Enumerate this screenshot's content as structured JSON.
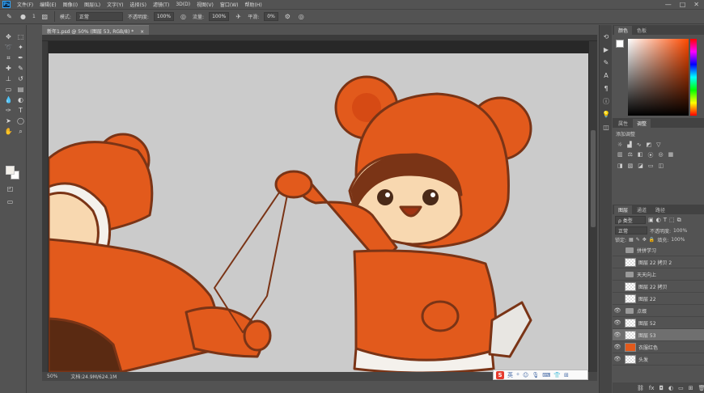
{
  "menubar": {
    "logo": "Ps",
    "items": [
      "文件(F)",
      "编辑(E)",
      "图像(I)",
      "图层(L)",
      "文字(Y)",
      "选择(S)",
      "滤镜(T)",
      "3D(D)",
      "视图(V)",
      "窗口(W)",
      "帮助(H)"
    ],
    "window_controls": [
      "—",
      "□",
      "✕"
    ]
  },
  "options": {
    "brush_size": "1",
    "mode_label": "模式:",
    "mode_value": "正常",
    "opacity_label": "不透明度:",
    "opacity_value": "100%",
    "flow_label": "流量:",
    "flow_value": "100%",
    "smoothing_label": "平滑:",
    "smoothing_value": "0%"
  },
  "document": {
    "tab_title": "新年1.psd @ 50% (图层 53, RGB/8) *",
    "tab_close": "×"
  },
  "statusbar": {
    "zoom": "50%",
    "doc_size": "文档:24.9M/624.1M"
  },
  "ime": {
    "logo": "S",
    "mode": "英"
  },
  "panels": {
    "color_tabs": [
      "颜色",
      "色板"
    ],
    "adjust_tabs": [
      "属性",
      "调整"
    ],
    "adjust_title": "添加调整",
    "layer_tabs": [
      "图层",
      "通道",
      "路径"
    ],
    "filter_label": "ρ 类型",
    "blend_mode": "正常",
    "opacity_label": "不透明度:",
    "opacity_value": "100%",
    "lock_label": "锁定:",
    "fill_label": "填充:",
    "fill_value": "100%"
  },
  "layers": [
    {
      "name": "拼拼学习",
      "type": "folder",
      "visible": false,
      "selected": false
    },
    {
      "name": "图层 22 拷贝 2",
      "type": "layer",
      "visible": false,
      "selected": false
    },
    {
      "name": "天天向上",
      "type": "folder",
      "visible": false,
      "selected": false
    },
    {
      "name": "图层 22 拷贝",
      "type": "layer",
      "visible": false,
      "selected": false
    },
    {
      "name": "图层 22",
      "type": "layer",
      "visible": false,
      "selected": false
    },
    {
      "name": "点缀",
      "type": "folder",
      "visible": true,
      "selected": false
    },
    {
      "name": "图层 52",
      "type": "layer",
      "visible": true,
      "selected": false
    },
    {
      "name": "图层 53",
      "type": "layer",
      "visible": true,
      "selected": true
    },
    {
      "name": "衣服红色",
      "type": "layer",
      "visible": true,
      "selected": false
    },
    {
      "name": "头发",
      "type": "layer",
      "visible": true,
      "selected": false
    }
  ],
  "colors": {
    "orange": "#e25a1c",
    "outline": "#7a3416",
    "canvas_bg": "#cbcbcb"
  }
}
